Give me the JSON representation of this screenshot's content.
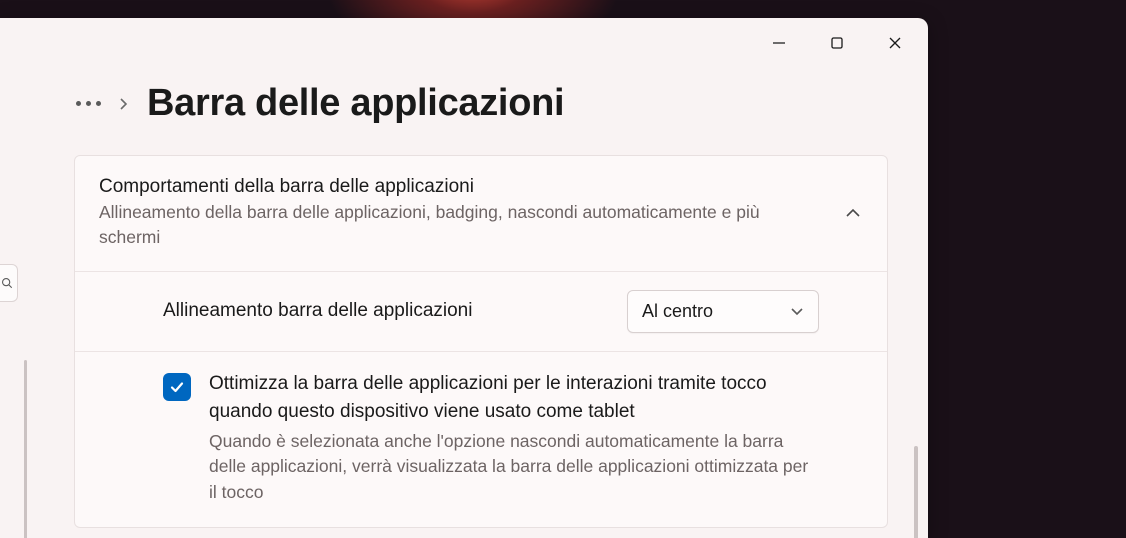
{
  "header": {
    "title": "Barra delle applicazioni"
  },
  "panel": {
    "title": "Comportamenti della barra delle applicazioni",
    "subtitle": "Allineamento della barra delle applicazioni, badging, nascondi automaticamente e più schermi"
  },
  "alignment": {
    "label": "Allineamento barra delle applicazioni",
    "value": "Al centro"
  },
  "touch": {
    "title": "Ottimizza la barra delle applicazioni per le interazioni tramite tocco quando questo dispositivo viene usato come tablet",
    "subtitle": "Quando è selezionata anche l'opzione nascondi automaticamente la barra delle applicazioni, verrà visualizzata la barra delle applicazioni ottimizzata per il tocco",
    "checked": true
  }
}
